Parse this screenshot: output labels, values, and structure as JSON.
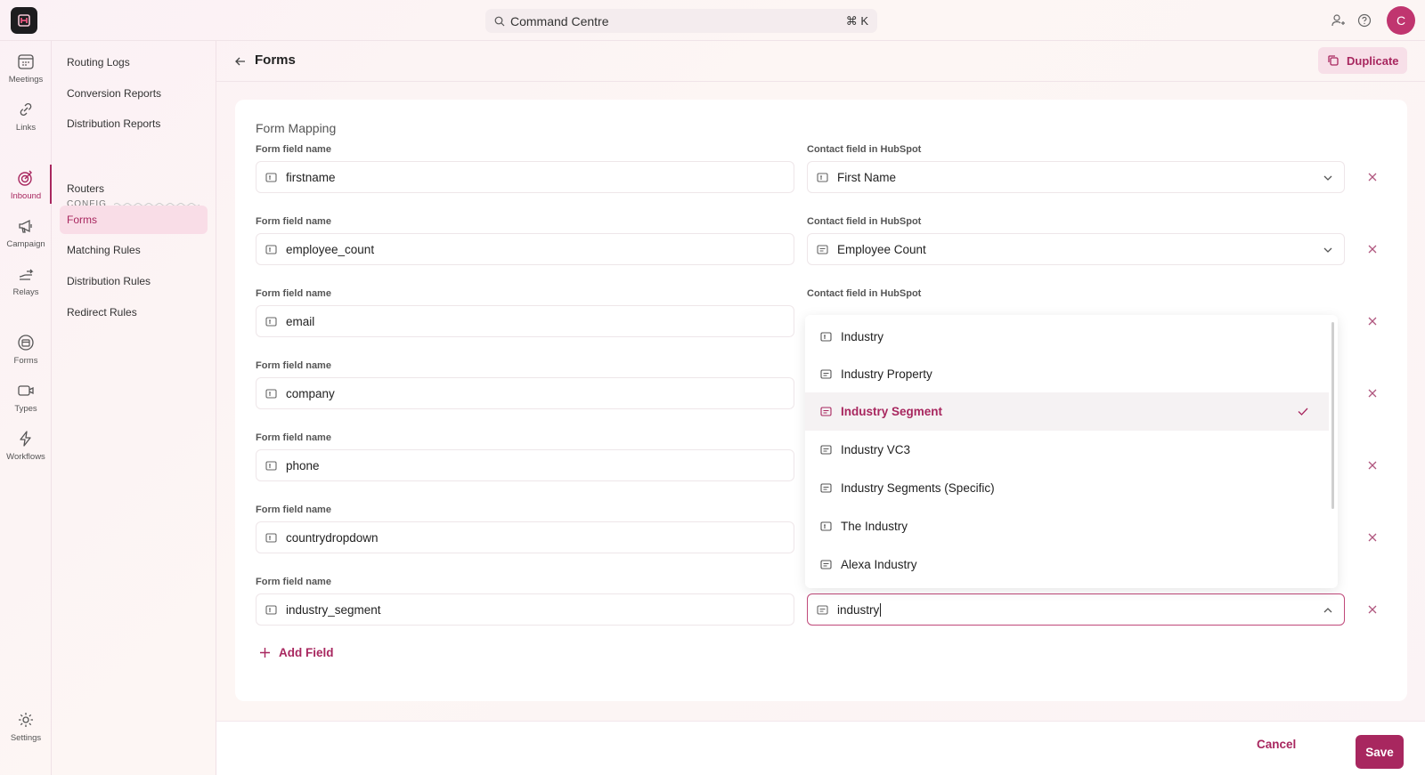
{
  "topbar": {
    "command_placeholder": "Command Centre",
    "shortcut": "⌘ K",
    "avatar_initial": "C"
  },
  "rail": {
    "items": [
      {
        "label": "Meetings",
        "icon": "calendar-icon"
      },
      {
        "label": "Links",
        "icon": "link-icon"
      },
      {
        "label": "Inbound",
        "icon": "target-icon",
        "active": true
      },
      {
        "label": "Campaign",
        "icon": "megaphone-icon"
      },
      {
        "label": "Relays",
        "icon": "relay-icon"
      },
      {
        "label": "Forms",
        "icon": "form-icon"
      },
      {
        "label": "Types",
        "icon": "video-icon"
      },
      {
        "label": "Workflows",
        "icon": "bolt-icon"
      },
      {
        "label": "Settings",
        "icon": "gear-icon"
      }
    ]
  },
  "subnav": {
    "items": [
      {
        "label": "Routing Logs"
      },
      {
        "label": "Conversion Reports"
      },
      {
        "label": "Distribution Reports"
      }
    ],
    "config_label": "CONFIG",
    "config_items": [
      {
        "label": "Routers"
      },
      {
        "label": "Forms",
        "active": true
      },
      {
        "label": "Matching Rules"
      },
      {
        "label": "Distribution Rules"
      },
      {
        "label": "Redirect Rules"
      }
    ]
  },
  "header": {
    "title": "Forms",
    "duplicate_label": "Duplicate"
  },
  "form_mapping": {
    "title": "Form Mapping",
    "form_field_label": "Form field name",
    "contact_field_label": "Contact field in HubSpot",
    "rows": [
      {
        "form_field": "firstname",
        "contact_field": "First Name"
      },
      {
        "form_field": "employee_count",
        "contact_field": "Employee Count"
      },
      {
        "form_field": "email",
        "contact_field": ""
      },
      {
        "form_field": "company",
        "contact_field": ""
      },
      {
        "form_field": "phone",
        "contact_field": ""
      },
      {
        "form_field": "countrydropdown",
        "contact_field": ""
      },
      {
        "form_field": "industry_segment",
        "contact_field": "industry"
      }
    ],
    "dropdown_options": [
      {
        "label": "Industry"
      },
      {
        "label": "Industry Property"
      },
      {
        "label": "Industry Segment",
        "selected": true
      },
      {
        "label": "Industry VC3"
      },
      {
        "label": "Industry Segments (Specific)"
      },
      {
        "label": "The Industry"
      },
      {
        "label": "Alexa Industry"
      }
    ],
    "add_field_label": "Add Field"
  },
  "footer": {
    "cancel_label": "Cancel",
    "save_label": "Save"
  },
  "colors": {
    "accent": "#a8275f",
    "avatar": "#c0356f",
    "active_bg": "#f9dde7"
  }
}
